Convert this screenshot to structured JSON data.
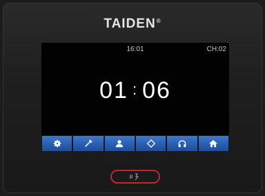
{
  "brand": {
    "name": "TAIDEN",
    "mark": "®"
  },
  "status": {
    "clock": "16:01",
    "channel": "CH:02"
  },
  "timer": {
    "minutes": "01",
    "separator": ":",
    "seconds": "06"
  },
  "toolbar": {
    "buttons": [
      {
        "icon": "gear-icon"
      },
      {
        "icon": "microphone-icon"
      },
      {
        "icon": "user-icon"
      },
      {
        "icon": "diamond-icon"
      },
      {
        "icon": "headphones-icon"
      },
      {
        "icon": "home-icon"
      }
    ]
  },
  "colors": {
    "toolbar": "#2a5fb0",
    "talk_ring": "#c0262c"
  }
}
